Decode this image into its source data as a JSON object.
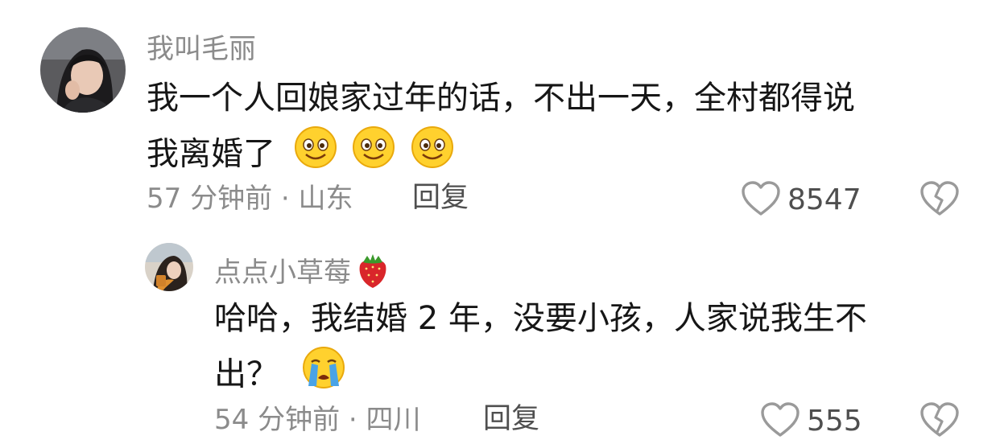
{
  "comment": {
    "username": "我叫毛丽",
    "text_line1": "我一个人回娘家过年的话，不出一天，全村都得说",
    "text_line2": "我离婚了",
    "emojis": [
      "smile-emoji",
      "smile-emoji",
      "smile-emoji"
    ],
    "time_location": "57 分钟前 · 山东",
    "reply_label": "回复",
    "likes": "8547"
  },
  "reply": {
    "username": "点点小草莓",
    "name_emoji": "strawberry-emoji",
    "text_line1": "哈哈，我结婚 2 年，没要小孩，人家说我生不",
    "text_line2": "出？",
    "emoji": "crying-emoji",
    "time_location": "54 分钟前 · 四川",
    "reply_label": "回复",
    "likes": "555"
  },
  "colors": {
    "text": "#161616",
    "muted": "#8b8b8b",
    "action": "#4f4f4f",
    "icon_stroke": "#9a9a9a"
  }
}
